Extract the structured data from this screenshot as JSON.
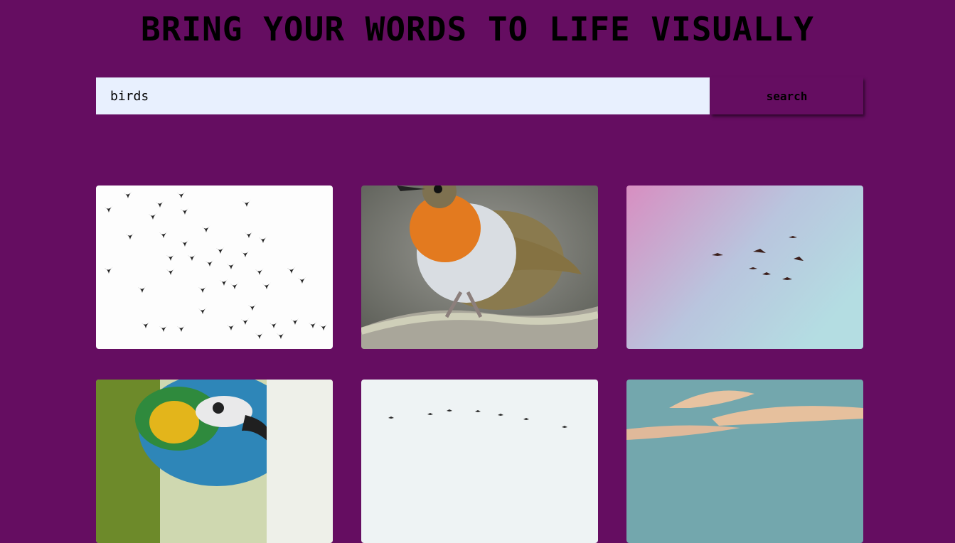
{
  "header": {
    "title": "BRING YOUR WORDS TO LIFE VISUALLY"
  },
  "search": {
    "value": "birds",
    "button_label": "search"
  },
  "colors": {
    "background": "#650d61",
    "input_background": "#e8f0fe"
  },
  "results": [
    {
      "subject": "flock of birds silhouette on white sky"
    },
    {
      "subject": "robin perched on a branch"
    },
    {
      "subject": "birds flying in pink and blue sky"
    },
    {
      "subject": "macaw parrot close-up"
    },
    {
      "subject": "birds in formation in pale sky"
    },
    {
      "subject": "cloudy sunset sky"
    }
  ]
}
